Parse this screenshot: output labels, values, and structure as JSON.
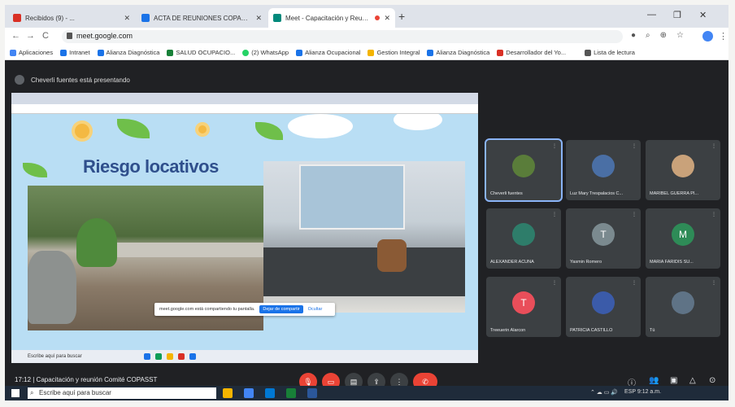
{
  "browser": {
    "tabs": [
      {
        "label": "Recibidos (9) - ...",
        "favicon_color": "#d93025"
      },
      {
        "label": "ACTA DE REUNIONES COPASST",
        "favicon_color": "#1a73e8"
      },
      {
        "label": "Meet - Capacitación y Reuni...",
        "favicon_color": "#00897b"
      }
    ],
    "new_tab": "+",
    "url": "meet.google.com",
    "bookmarks": [
      "Aplicaciones",
      "Intranet",
      "Alianza Diagnóstica",
      "SALUD OCUPACIO...",
      "(2) WhatsApp",
      "Alianza Ocupacional",
      "Gestion Integral",
      "Alianza Diagnóstica",
      "Desarrollador del Yo...",
      "Lista de lectura"
    ]
  },
  "meet": {
    "presenting_text": "Cheverli fuentes está presentando",
    "slide": {
      "title": "Riesgo locativos",
      "notification": "meet.google.com está compartiendo tu pantalla.",
      "notification_stop": "Dejar de compartir",
      "notification_hide": "Ocultar",
      "inner_search": "Escribe aquí para buscar"
    },
    "participants": [
      {
        "name": "Cheverli fuentes",
        "initial": "",
        "color": "#5a7d3a",
        "pinned": true
      },
      {
        "name": "Luz Mary Trespalacios C...",
        "initial": "",
        "color": "#4a6fa5",
        "pinned": false
      },
      {
        "name": "MARIBEL GUERRA PI...",
        "initial": "",
        "color": "#c9a27a",
        "pinned": false
      },
      {
        "name": "ALEXANDER ACUÑA",
        "initial": "",
        "color": "#2e7d6a",
        "pinned": false
      },
      {
        "name": "Yasmin Romero",
        "initial": "T",
        "color": "#7b8a8f",
        "pinned": false
      },
      {
        "name": "MARIA FARIDIS SU...",
        "initial": "M",
        "color": "#2e8b57",
        "pinned": false
      },
      {
        "name": "Treeuerin Alarcon",
        "initial": "T",
        "color": "#e94e5a",
        "pinned": false
      },
      {
        "name": "PATRICIA CASTILLO",
        "initial": "",
        "color": "#3b5ba9",
        "pinned": false
      },
      {
        "name": "Tú",
        "initial": "",
        "color": "#5f7386",
        "pinned": false
      }
    ],
    "meeting_info": "17:12 | Capacitación y reunión Comité COPASST"
  },
  "taskbar": {
    "search_placeholder": "Escribe aquí para buscar",
    "tray_text": "ESP 9:12 a.m."
  }
}
